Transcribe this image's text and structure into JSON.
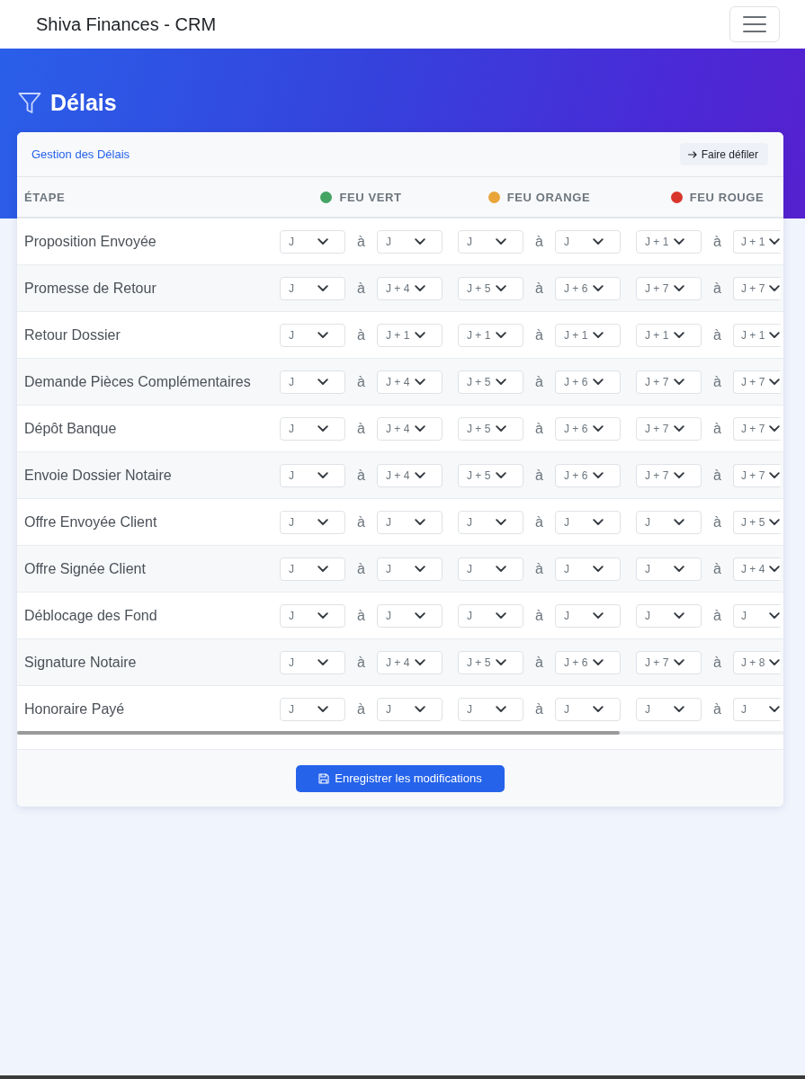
{
  "navbar": {
    "brand": "Shiva Finances - CRM"
  },
  "page_header": {
    "title": "Délais"
  },
  "card": {
    "title": "Gestion des Délais",
    "scroll_button": "Faire défiler",
    "table": {
      "columns": [
        {
          "label": "ÉTAPE"
        },
        {
          "label": "FEU VERT",
          "color": "#43a464"
        },
        {
          "label": "FEU ORANGE",
          "color": "#e9a53a"
        },
        {
          "label": "FEU ROUGE",
          "color": "#d9362b"
        }
      ],
      "rows": [
        {
          "step": "Proposition Envoyée",
          "ranges": [
            {
              "from": "J",
              "separator": "à",
              "to": "J"
            },
            {
              "from": "J",
              "separator": "à",
              "to": "J"
            },
            {
              "from": "J + 1",
              "separator": "à",
              "to": "J + 1"
            }
          ]
        },
        {
          "step": "Promesse de Retour",
          "ranges": [
            {
              "from": "J",
              "separator": "à",
              "to": "J + 4"
            },
            {
              "from": "J + 5",
              "separator": "à",
              "to": "J + 6"
            },
            {
              "from": "J + 7",
              "separator": "à",
              "to": "J + 7"
            }
          ]
        },
        {
          "step": "Retour Dossier",
          "ranges": [
            {
              "from": "J",
              "separator": "à",
              "to": "J + 1"
            },
            {
              "from": "J + 1",
              "separator": "à",
              "to": "J + 1"
            },
            {
              "from": "J + 1",
              "separator": "à",
              "to": "J + 1"
            }
          ]
        },
        {
          "step": "Demande Pièces Complémentaires",
          "ranges": [
            {
              "from": "J",
              "separator": "à",
              "to": "J + 4"
            },
            {
              "from": "J + 5",
              "separator": "à",
              "to": "J + 6"
            },
            {
              "from": "J + 7",
              "separator": "à",
              "to": "J + 7"
            }
          ]
        },
        {
          "step": "Dépôt Banque",
          "ranges": [
            {
              "from": "J",
              "separator": "à",
              "to": "J + 4"
            },
            {
              "from": "J + 5",
              "separator": "à",
              "to": "J + 6"
            },
            {
              "from": "J + 7",
              "separator": "à",
              "to": "J + 7"
            }
          ]
        },
        {
          "step": "Envoie Dossier Notaire",
          "ranges": [
            {
              "from": "J",
              "separator": "à",
              "to": "J + 4"
            },
            {
              "from": "J + 5",
              "separator": "à",
              "to": "J + 6"
            },
            {
              "from": "J + 7",
              "separator": "à",
              "to": "J + 7"
            }
          ]
        },
        {
          "step": "Offre Envoyée Client",
          "ranges": [
            {
              "from": "J",
              "separator": "à",
              "to": "J"
            },
            {
              "from": "J",
              "separator": "à",
              "to": "J"
            },
            {
              "from": "J",
              "separator": "à",
              "to": "J + 5"
            }
          ]
        },
        {
          "step": "Offre Signée Client",
          "ranges": [
            {
              "from": "J",
              "separator": "à",
              "to": "J"
            },
            {
              "from": "J",
              "separator": "à",
              "to": "J"
            },
            {
              "from": "J",
              "separator": "à",
              "to": "J + 4"
            }
          ]
        },
        {
          "step": "Déblocage des Fond",
          "ranges": [
            {
              "from": "J",
              "separator": "à",
              "to": "J"
            },
            {
              "from": "J",
              "separator": "à",
              "to": "J"
            },
            {
              "from": "J",
              "separator": "à",
              "to": "J"
            }
          ]
        },
        {
          "step": "Signature Notaire",
          "ranges": [
            {
              "from": "J",
              "separator": "à",
              "to": "J + 4"
            },
            {
              "from": "J + 5",
              "separator": "à",
              "to": "J + 6"
            },
            {
              "from": "J + 7",
              "separator": "à",
              "to": "J + 8"
            }
          ]
        },
        {
          "step": "Honoraire Payé",
          "ranges": [
            {
              "from": "J",
              "separator": "à",
              "to": "J"
            },
            {
              "from": "J",
              "separator": "à",
              "to": "J"
            },
            {
              "from": "J",
              "separator": "à",
              "to": "J"
            }
          ]
        }
      ]
    }
  },
  "footer": {
    "save_button": "Enregistrer les modifications"
  }
}
